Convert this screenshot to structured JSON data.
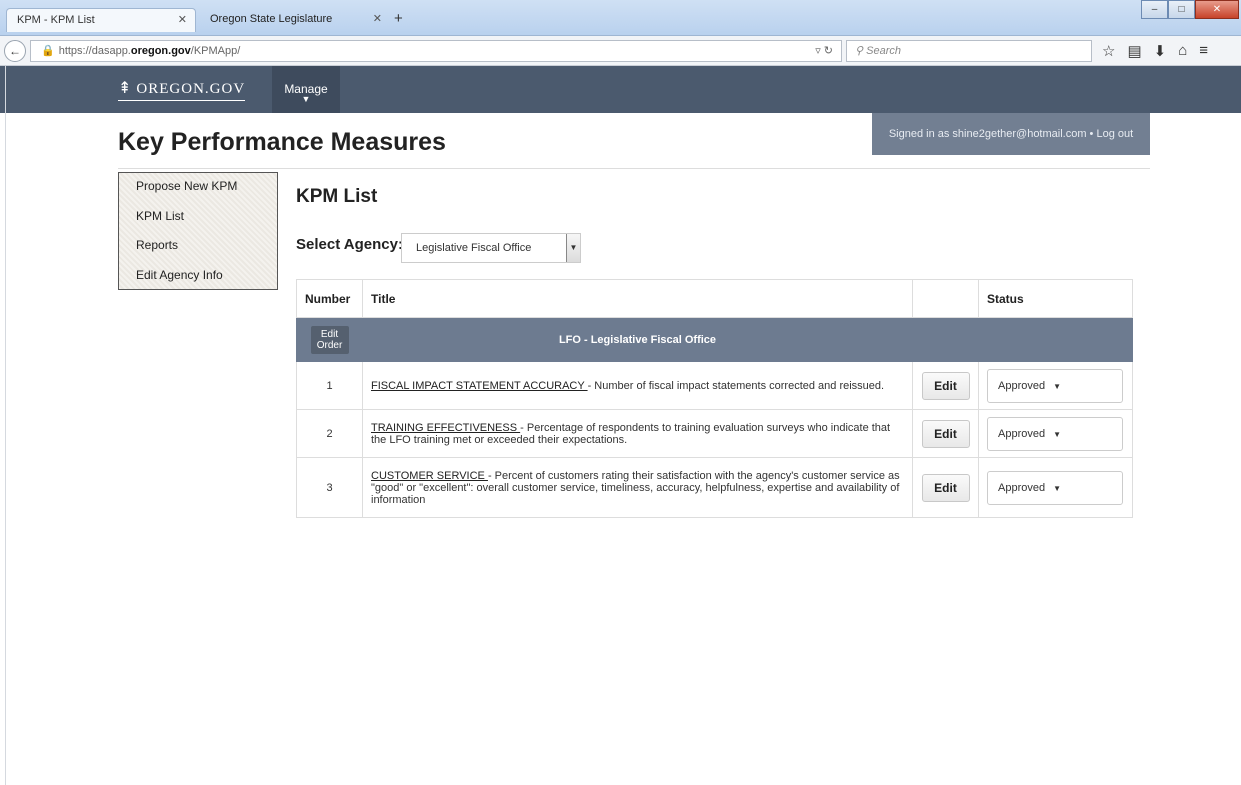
{
  "browser": {
    "tabs": [
      {
        "label": "KPM - KPM List",
        "active": true
      },
      {
        "label": "Oregon State Legislature",
        "active": false
      }
    ],
    "url_prefix": "https://dasapp.",
    "url_domain": "oregon.gov",
    "url_path": "/KPMApp/",
    "search_placeholder": "Search"
  },
  "site": {
    "logo_text": "OREGON.GOV",
    "menu": {
      "manage_label": "Manage"
    },
    "page_title": "Key Performance Measures",
    "signed_in_text": "Signed in as shine2gether@hotmail.com • Log out"
  },
  "sidebar": {
    "items": [
      {
        "label": "Propose New KPM"
      },
      {
        "label": "KPM List"
      },
      {
        "label": "Reports"
      },
      {
        "label": "Edit Agency Info"
      }
    ]
  },
  "main": {
    "title": "KPM List",
    "agency_label": "Select Agency:",
    "agency_selected": "Legislative Fiscal Office",
    "table": {
      "headers": [
        "Number",
        "Title",
        "",
        "Status"
      ],
      "group_button_line1": "Edit",
      "group_button_line2": "Order",
      "group_label": "LFO - Legislative Fiscal Office",
      "rows": [
        {
          "number": "1",
          "link": "FISCAL IMPACT STATEMENT ACCURACY ",
          "desc": "- Number of fiscal impact statements corrected and reissued.",
          "edit": "Edit",
          "status": "Approved"
        },
        {
          "number": "2",
          "link": "TRAINING EFFECTIVENESS ",
          "desc": "- Percentage of respondents to training evaluation surveys who indicate that the LFO training met or exceeded their expectations.",
          "edit": "Edit",
          "status": "Approved"
        },
        {
          "number": "3",
          "link": "CUSTOMER SERVICE ",
          "desc": "- Percent of customers rating their satisfaction with the agency's customer service as \"good\" or \"excellent\": overall customer service, timeliness, accuracy, helpfulness, expertise and availability of information",
          "edit": "Edit",
          "status": "Approved"
        }
      ]
    }
  }
}
